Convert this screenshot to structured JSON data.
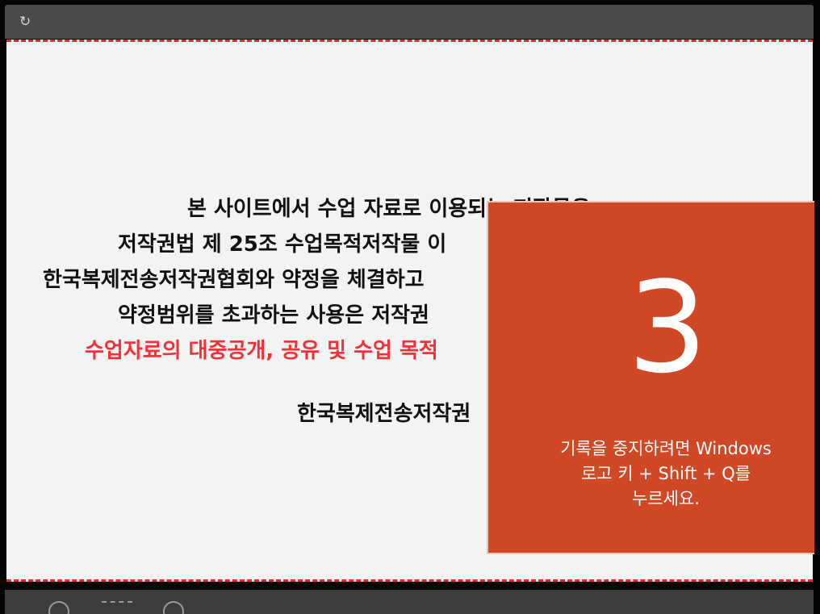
{
  "titlebar": {
    "refresh_icon": "refresh-icon",
    "refresh_glyph": "↻"
  },
  "notice": {
    "line1": "본 사이트에서 수업 자료로 이용되는 저작물은",
    "line2": "저작권법 제 25조 수업목적저작물 이",
    "line3": "한국복제전송저작권협회와 약정을 체결하고",
    "line4": "약정범위를 초과하는 사용은 저작권",
    "line5": "수업자료의 대중공개, 공유 및 수업 목적",
    "line6": "한국복제전송저작권"
  },
  "countdown": {
    "number": "3",
    "message": "기록을 중지하려면 Windows\n로고 키 + Shift + Q를\n누르세요."
  },
  "colors": {
    "countdown_bg": "#d14827",
    "dash_border": "#e8272b",
    "highlight_text": "#f0323a"
  }
}
